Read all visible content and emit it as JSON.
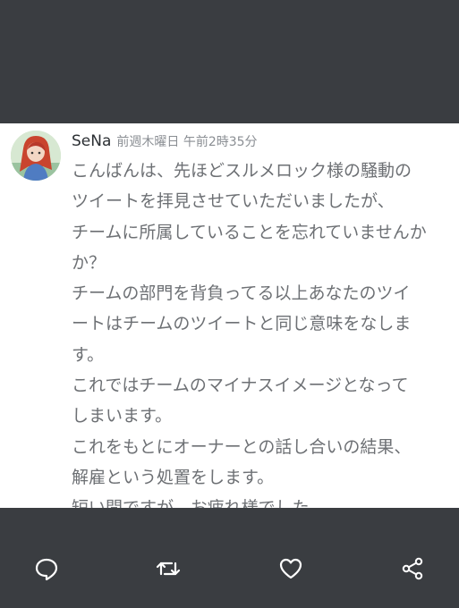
{
  "tweet": {
    "username": "SeNa",
    "timestamp": "前週木曜日 午前2時35分",
    "lines": [
      "こんばんは、先ほどスルメロック様の騒動の",
      "ツイートを拝見させていただいましたが、",
      "チームに所属していることを忘れていませんか",
      "か？",
      "チームの部門を背負ってる以上あなたのツイ",
      "ートはチームのツイートと同じ意味をなしま",
      "す。",
      "これではチームのマイナスイメージとなって",
      "しまいます。",
      "これをもとにオーナーとの話し合いの結果、",
      "解雇という処置をします。",
      "短い間ですが、お疲れ様でした。"
    ]
  },
  "actions": {
    "reply_icon": "reply-icon",
    "retweet_icon": "retweet-icon",
    "like_icon": "heart-icon",
    "share_icon": "share-icon"
  },
  "colors": {
    "background_dark": "#3a3d41",
    "card": "#ffffff",
    "text": "#6d7074",
    "timestamp": "#8a8e93",
    "icon": "#ffffff"
  }
}
